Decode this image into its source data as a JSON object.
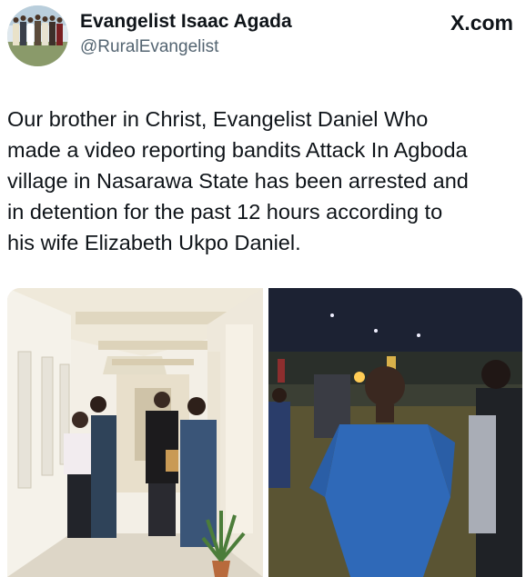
{
  "author": {
    "display_name": "Evangelist Isaac Agada",
    "handle": "@RuralEvangelist"
  },
  "source_label": "X.com",
  "tweet": {
    "text": "Our brother in Christ, Evangelist Daniel Who\nmade a video reporting bandits Attack In Agboda\nvillage in Nasarawa State has been arrested  and\nin detention for the past 12 hours according to\nhis wife Elizabeth Ukpo Daniel."
  },
  "media": [
    {
      "name": "corridor-photo"
    },
    {
      "name": "night-crowd-photo"
    }
  ],
  "colors": {
    "text_primary": "#0f1419",
    "text_secondary": "#536471",
    "background": "#ffffff"
  }
}
